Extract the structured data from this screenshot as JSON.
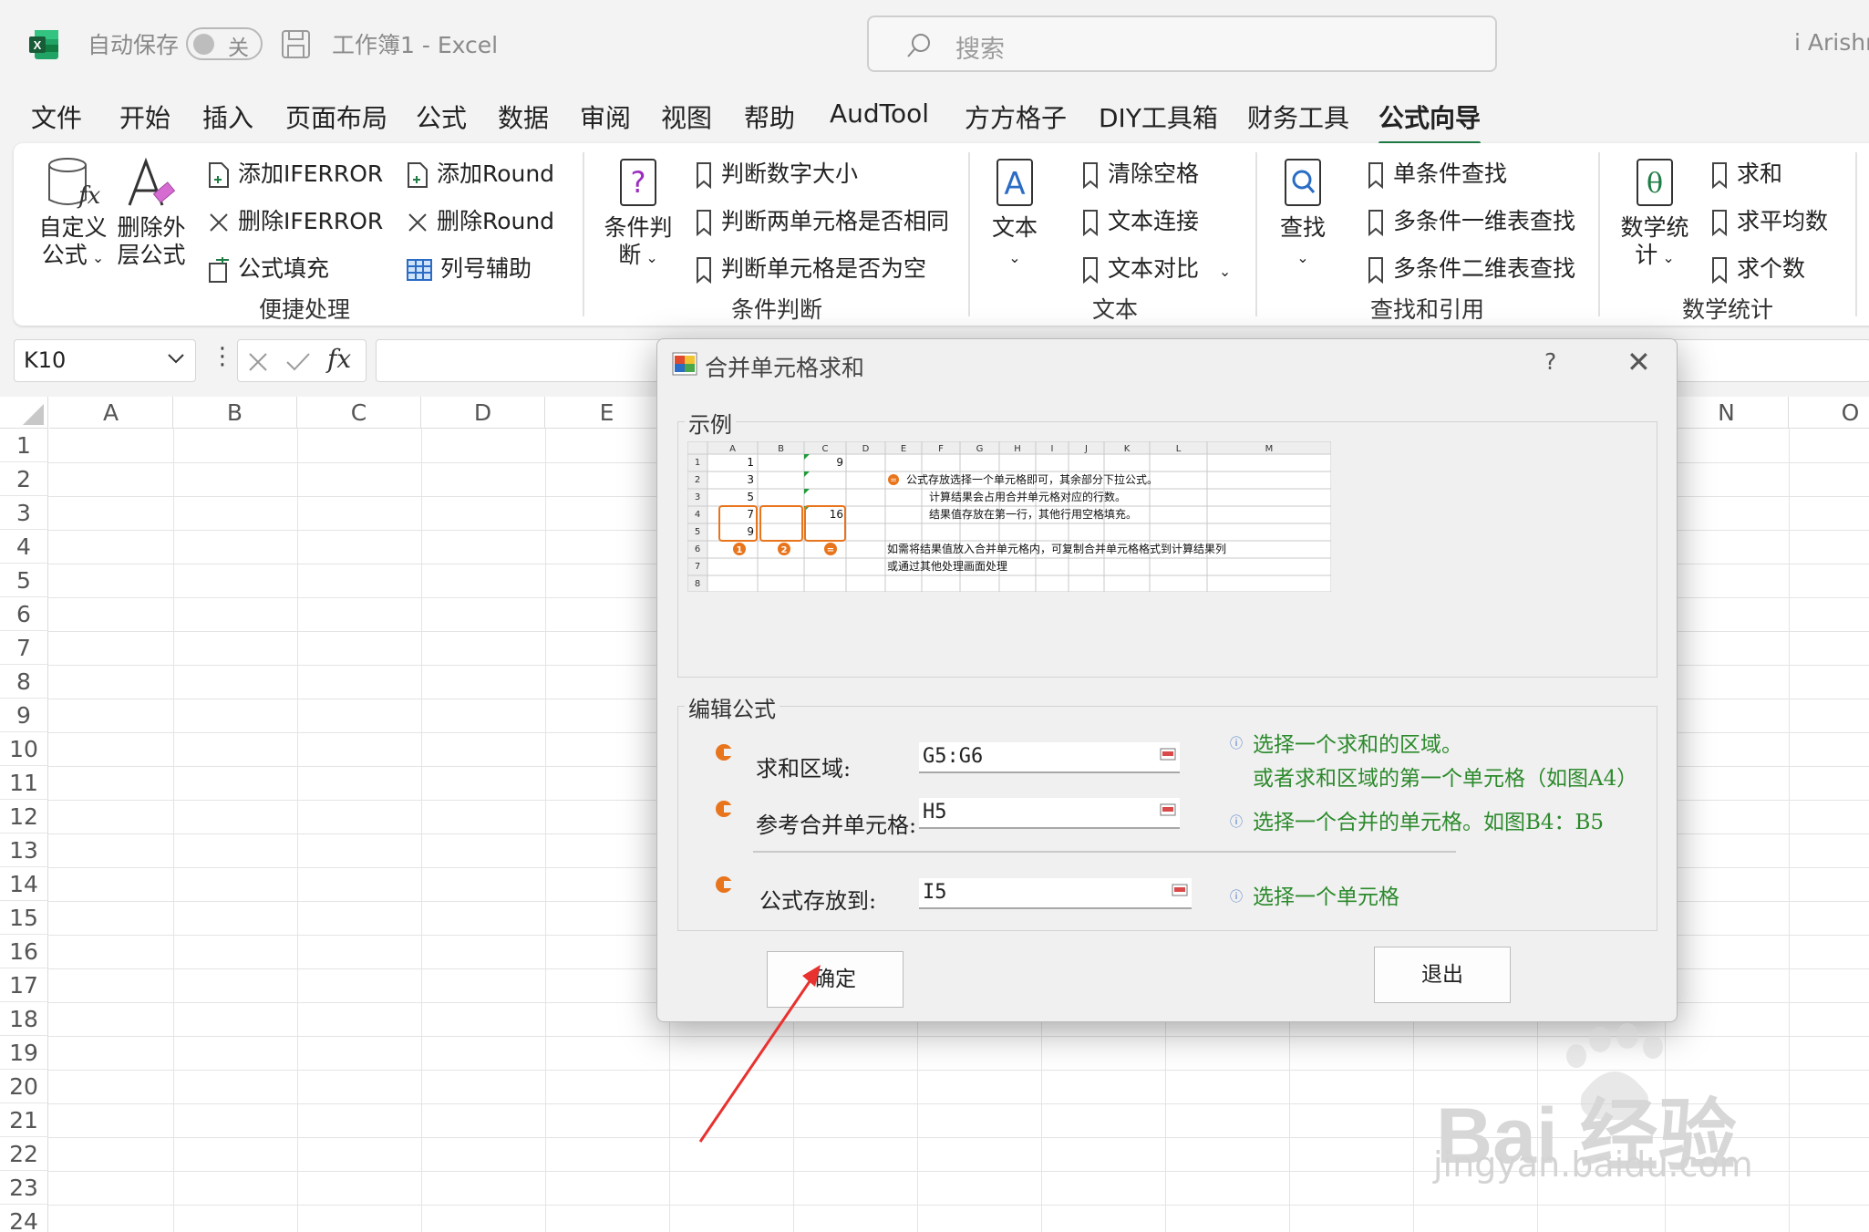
{
  "titlebar": {
    "autosave_label": "自动保存",
    "autosave_state": "关",
    "document_title": "工作簿1  -  Excel",
    "search_placeholder": "搜索",
    "account_name": "i Arishn"
  },
  "menu": {
    "tabs": [
      "文件",
      "开始",
      "插入",
      "页面布局",
      "公式",
      "数据",
      "审阅",
      "视图",
      "帮助",
      "AudTool",
      "方方格子",
      "DIY工具箱",
      "财务工具",
      "公式向导"
    ],
    "active_tab": "公式向导"
  },
  "ribbon": {
    "quick": {
      "custom_formula": "自定义公式",
      "custom_formula_line1": "自定义",
      "custom_formula_line2": "公式",
      "remove_outer_line1": "删除外",
      "remove_outer_line2": "层公式",
      "add_iferror": "添加IFERROR",
      "del_iferror": "删除IFERROR",
      "formula_fill": "公式填充",
      "add_round": "添加Round",
      "del_round": "删除Round",
      "col_helper": "列号辅助",
      "group": "便捷处理"
    },
    "condition": {
      "big_line1": "条件判",
      "big_line2": "断",
      "num_size": "判断数字大小",
      "same_cells": "判断两单元格是否相同",
      "is_empty": "判断单元格是否为空",
      "group": "条件判断"
    },
    "text": {
      "big": "文本",
      "trim": "清除空格",
      "concat": "文本连接",
      "compare": "文本对比",
      "group": "文本"
    },
    "lookup": {
      "big": "查找",
      "single": "单条件查找",
      "multi_1d": "多条件一维表查找",
      "multi_2d": "多条件二维表查找",
      "group": "查找和引用"
    },
    "math": {
      "big_line1": "数学统",
      "big_line2": "计",
      "sum": "求和",
      "avg": "求平均数",
      "count": "求个数",
      "group": "数学统计"
    }
  },
  "formula_bar": {
    "name_box": "K10",
    "fx": "fx"
  },
  "sheet": {
    "columns": [
      "A",
      "B",
      "C",
      "D",
      "E",
      "N",
      "O"
    ],
    "rows": [
      "1",
      "2",
      "3",
      "4",
      "5",
      "6",
      "7",
      "8",
      "9",
      "10",
      "11",
      "12",
      "13",
      "14",
      "15",
      "16",
      "17",
      "18",
      "19",
      "20",
      "21",
      "22",
      "23",
      "24"
    ]
  },
  "dialog": {
    "title": "合并单元格求和",
    "help": "?",
    "close": "✕",
    "example_legend": "示例",
    "edit_legend": "编辑公式",
    "sum_range_label": "求和区域:",
    "sum_range_value": "G5:G6",
    "ref_merged_label": "参考合并单元格:",
    "ref_merged_value": "H5",
    "output_label": "公式存放到:",
    "output_value": "I5",
    "hint_sum_1": "选择一个求和的区域。",
    "hint_sum_2": "或者求和区域的第一个单元格（如图A4）",
    "hint_ref": "选择一个合并的单元格。如图B4：B5",
    "hint_out": "选择一个单元格",
    "ok": "确定",
    "exit": "退出"
  },
  "example": {
    "col_headers": [
      "A",
      "B",
      "C",
      "D",
      "E",
      "F",
      "G",
      "H",
      "I",
      "J",
      "K",
      "L",
      "M"
    ],
    "row_headers": [
      "1",
      "2",
      "3",
      "4",
      "5",
      "6",
      "7",
      "8"
    ],
    "a_values": [
      "1",
      "3",
      "5",
      "7",
      "9"
    ],
    "c1_value": "9",
    "c4_value": "16",
    "note1": "公式存放选择一个单元格即可，其余部分下拉公式。",
    "note2": "计算结果会占用合并单元格对应的行数。",
    "note3": "结果值存放在第一行，其他行用空格填充。",
    "note4": "如需将结果值放入合并单元格内，可复制合并单元格格式到计算结果列",
    "note5": "或通过其他处理画面处理",
    "marker1": "1",
    "marker2": "2",
    "marker3": "="
  },
  "watermark": {
    "brand": "Bai 经验",
    "url": "jingyan.baidu.com"
  },
  "colors": {
    "excel_green": "#1e7c45",
    "hint_green": "#2c8a2c",
    "marker_orange": "#e8741c",
    "arrow_red": "#e8322f"
  }
}
